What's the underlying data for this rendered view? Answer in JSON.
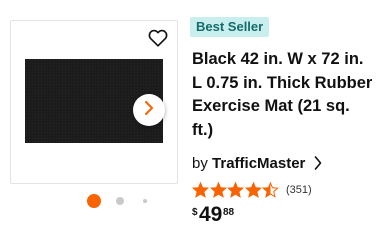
{
  "badge": {
    "label": "Best Seller"
  },
  "product": {
    "title": "Black 42 in. W x 72 in. L 0.75 in. Thick Rubber Exercise Mat (21 sq. ft.)",
    "by_label": "by",
    "brand": "TrafficMaster",
    "rating": {
      "stars": 4.5,
      "max": 5,
      "reviews_text": "(351)"
    },
    "price": {
      "currency": "$",
      "dollars": "49",
      "cents": "88"
    },
    "image_color": "#1c1c1c"
  },
  "carousel": {
    "slide_count": 3,
    "active_index": 0,
    "active_color": "#f96302"
  },
  "icons": {
    "favorite": "heart-outline-icon",
    "next": "chevron-right-icon",
    "brand_link": "chevron-right-icon"
  },
  "colors": {
    "accent": "#f96302",
    "badge_bg": "#c8eeee",
    "badge_text": "#176b6b"
  }
}
